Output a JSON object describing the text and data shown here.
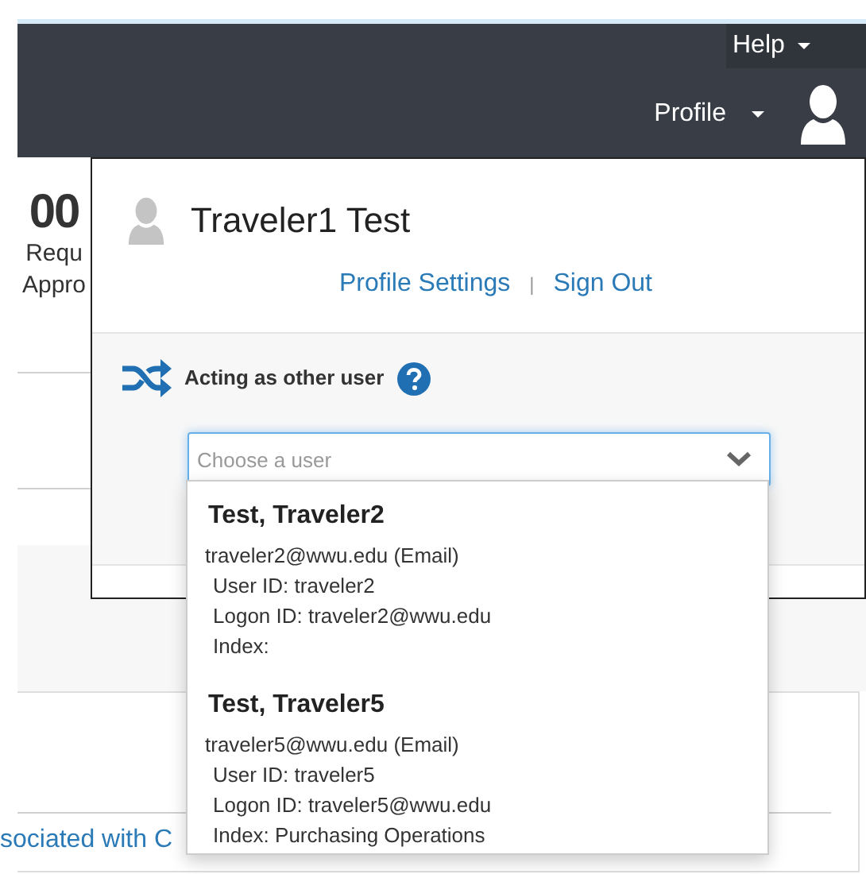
{
  "top_bar": {
    "help_menu": "Help",
    "profile_menu": "Profile"
  },
  "background": {
    "stat_value": "00",
    "stat_label_lines": [
      "Requ",
      "Appro"
    ],
    "link": "sociated with C"
  },
  "profile_popup": {
    "user_name": "Traveler1 Test",
    "links": [
      "Profile Settings",
      "Sign Out"
    ],
    "separator": "|",
    "acting_label": "Acting as other user",
    "user_select": {
      "placeholder": "Choose a user",
      "options": [
        {
          "name": "Test, Traveler2",
          "email": "traveler2@wwu.edu (Email)",
          "details": [
            "User ID: traveler2",
            "Logon ID: traveler2@wwu.edu",
            "Index:"
          ]
        },
        {
          "name": "Test, Traveler5",
          "email": "traveler5@wwu.edu (Email)",
          "details": [
            "User ID: traveler5",
            "Logon ID: traveler5@wwu.edu",
            "Index: Purchasing Operations"
          ]
        }
      ]
    }
  }
}
